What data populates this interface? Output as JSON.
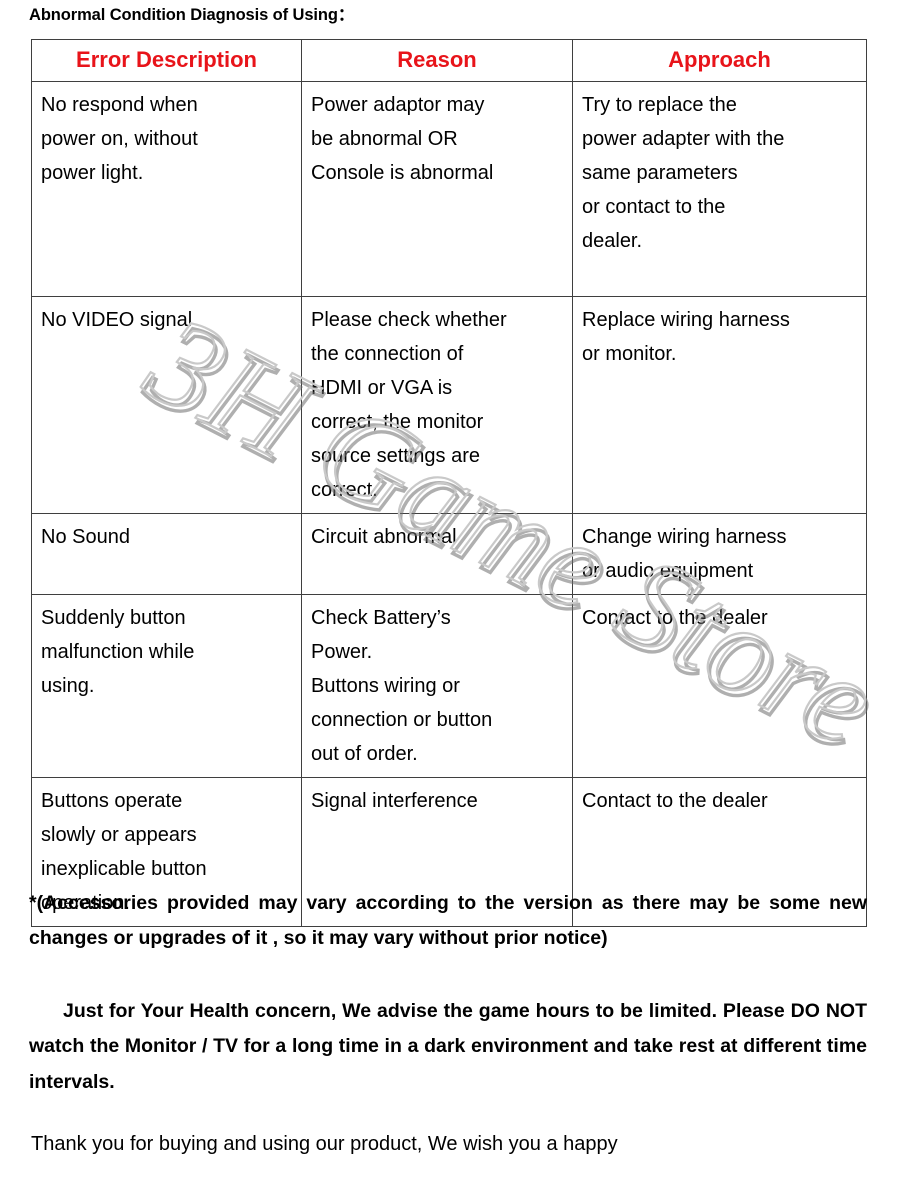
{
  "document": {
    "title": "Abnormal Condition Diagnosis of Using："
  },
  "table": {
    "headers": {
      "error_description": "Error Description",
      "reason": "Reason",
      "approach": "Approach"
    },
    "header_color": "#E8141A",
    "rows": [
      {
        "error_description": "No respond when\npower on, without\npower light.",
        "reason": "Power adaptor may\nbe abnormal OR\nConsole is abnormal",
        "approach": "Try to replace the\npower adapter with the\nsame parameters\nor contact to the\ndealer."
      },
      {
        "error_description": "No VIDEO signal",
        "reason": "Please check whether\nthe connection of\nHDMI or VGA is\ncorrect, the monitor\nsource settings are\ncorrect.",
        "approach": "Replace wiring harness\nor monitor."
      },
      {
        "error_description": "No Sound",
        "reason": "Circuit abnormal",
        "approach": "Change wiring harness\nor audio equipment"
      },
      {
        "error_description": "Suddenly button\nmalfunction while\nusing.",
        "reason": "Check Battery’s\nPower.\nButtons wiring or\nconnection or button\nout of order.",
        "approach": "Contact to the dealer"
      },
      {
        "error_description": "Buttons operate\nslowly or appears\ninexplicable button\noperation.",
        "reason": "Signal interference",
        "approach": "Contact to the dealer"
      }
    ]
  },
  "watermark": {
    "text": "3H Game Store"
  },
  "notes": {
    "accessories": "*(Accessories provided may vary according to the   version as   there may be some new changes or upgrades of it , so it   may   vary without prior notice)",
    "health": "Just for Your Health concern, We advise the game hours to be limited. Please DO NOT watch the Monitor / TV for a long time in a dark environment and take rest at different time intervals.",
    "thanks": "Thank you for buying and using our product, We wish you a happy"
  }
}
